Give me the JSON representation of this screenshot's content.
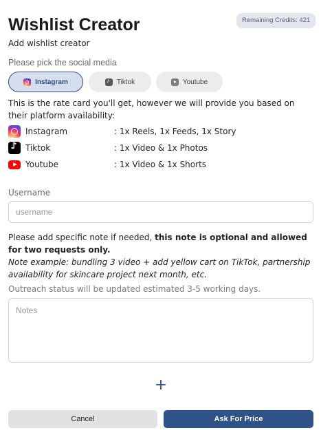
{
  "header": {
    "title": "Wishlist Creator",
    "credits": "Remaining Credits: 421",
    "subtitle": "Add wishlist creator"
  },
  "social": {
    "label": "Please pick the social media",
    "options": [
      {
        "label": "Instagram",
        "icon": "instagram-icon",
        "selected": true
      },
      {
        "label": "Tiktok",
        "icon": "tiktok-icon",
        "selected": false
      },
      {
        "label": "Youtube",
        "icon": "youtube-icon",
        "selected": false
      }
    ]
  },
  "rate_card": {
    "intro": "This is the rate card you'll get, however we will provide you based on their platform availability:",
    "rows": [
      {
        "platform": "Instagram",
        "value": ": 1x Reels, 1x Feeds, 1x Story"
      },
      {
        "platform": "Tiktok",
        "value": ": 1x Video & 1x Photos"
      },
      {
        "platform": "Youtube",
        "value": ": 1x Video & 1x Shorts"
      }
    ]
  },
  "username": {
    "label": "Username",
    "placeholder": "username",
    "value": ""
  },
  "note": {
    "text_plain": "Please add specific note if needed, ",
    "text_bold": "this note is optional and allowed for two requests only.",
    "example": "Note example: bundling 3 video + add yellow cart on TikTok, partnership availability for skincare project next month, etc.",
    "outreach": "Outreach status will be updated estimated 3-5 working days.",
    "placeholder": "Notes"
  },
  "actions": {
    "add_symbol": "+",
    "cancel": "Cancel",
    "ask": "Ask For Price"
  },
  "colors": {
    "primary": "#2f5288",
    "pill_active_bg": "#d5deec",
    "cancel_bg": "#e2e2e2"
  }
}
